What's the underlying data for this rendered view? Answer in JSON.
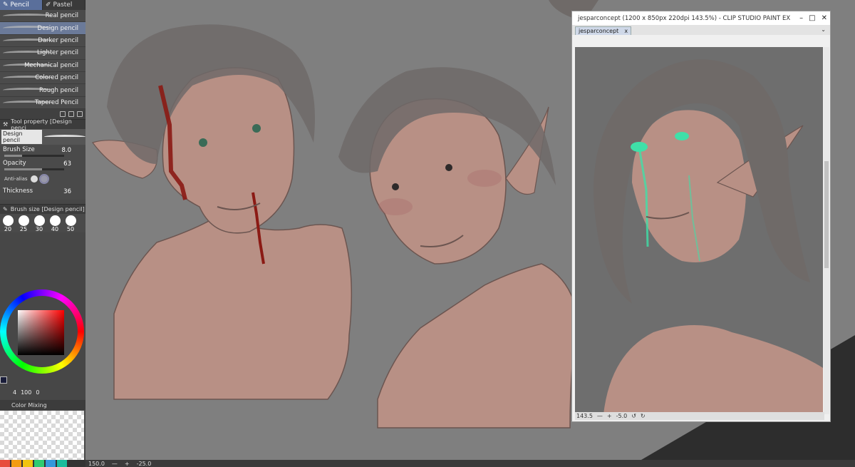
{
  "tool_tabs": {
    "pencil": "Pencil",
    "pastel": "Pastel"
  },
  "brushes": [
    "Real pencil",
    "Design pencil",
    "Darker pencil",
    "Lighter pencil",
    "Mechanical pencil",
    "Colored pencil",
    "Rough pencil",
    "Tapered Pencil"
  ],
  "selected_brush_index": 1,
  "tool_property": {
    "header": "Tool property [Design penci",
    "preset_name": "Design pencil",
    "brush_size_label": "Brush Size",
    "brush_size_value": "8.0",
    "opacity_label": "Opacity",
    "opacity_value": "63",
    "antialias_label": "Anti-alias",
    "thickness_label": "Thickness",
    "thickness_value": "36"
  },
  "brush_size_palette": {
    "header": "Brush size [Design pencil]",
    "sizes": [
      "20",
      "25",
      "30",
      "40",
      "50"
    ]
  },
  "color_status": {
    "a": "4",
    "b": "100",
    "c": "0"
  },
  "color_mixing_label": "Color Mixing",
  "swatches": [
    "#e74c3c",
    "#f39c12",
    "#f1c40f",
    "#2ecc71",
    "#3498db",
    "#1abc9c"
  ],
  "reference_window": {
    "title": "jesparconcept (1200 x 850px 220dpi 143.5%)  - CLIP STUDIO PAINT EX",
    "tab_label": "jesparconcept",
    "zoom": "143.5",
    "rotation": "-5.0"
  },
  "bottom_status": {
    "zoom": "150.0",
    "rotation": "-25.0"
  },
  "colors": {
    "canvas_bg": "#7f7f7f",
    "skin": "#b89085",
    "hair": "#6f6a68",
    "blood": "#8b1a14",
    "glow": "#3fe0a8",
    "panel": "#474747",
    "selected": "#6b7a99"
  }
}
